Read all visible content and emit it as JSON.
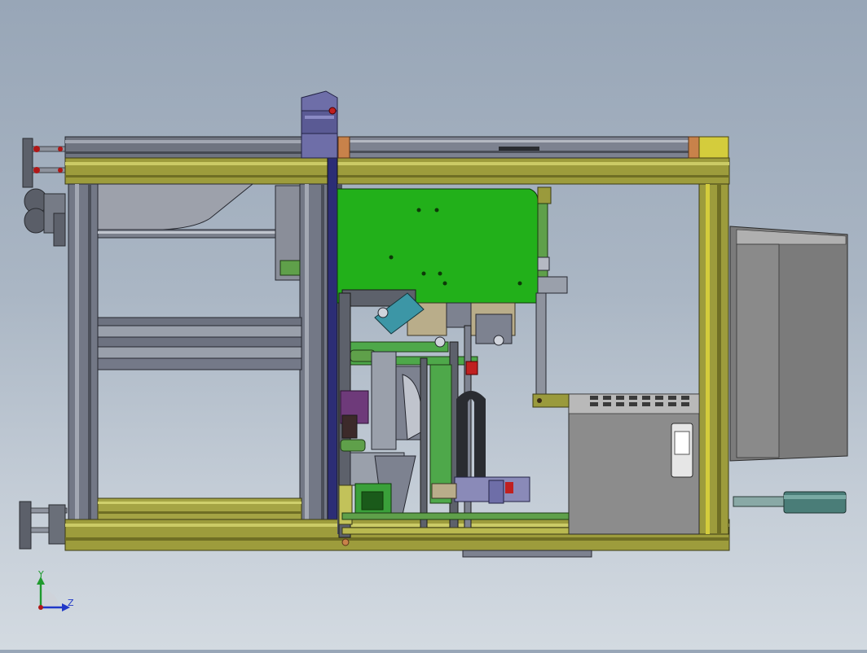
{
  "viewport": {
    "background_top": "#98a6b7",
    "background_bottom": "#d3dae1"
  },
  "triad": {
    "y_label": "Y",
    "z_label": "Z",
    "y_color": "#1f9a2e",
    "z_color": "#2038c8",
    "origin_color": "#b01818"
  },
  "colors": {
    "frame_olive": "#9a9a3c",
    "frame_olive_light": "#c2c25a",
    "frame_yellow": "#d4cc3c",
    "steel": "#7d8290",
    "steel_dark": "#4e525e",
    "steel_light": "#b5b9c3",
    "plate_green": "#22b01a",
    "panel_purple": "#6e6ea8",
    "cabinet_gray": "#7b7b7b",
    "cabinet_light": "#9c9c9c",
    "handle_teal": "#4a7d78",
    "copper": "#c8824a"
  }
}
